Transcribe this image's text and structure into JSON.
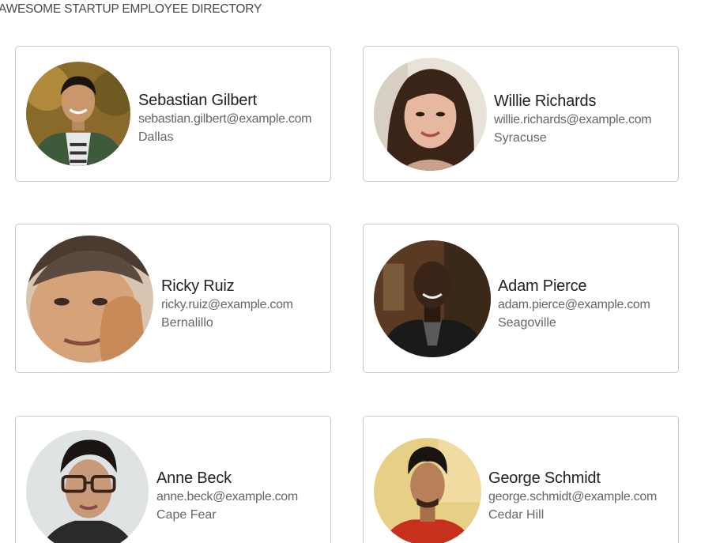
{
  "page": {
    "title": "AWESOME STARTUP EMPLOYEE DIRECTORY"
  },
  "employees": [
    {
      "name": "Sebastian Gilbert",
      "email": "sebastian.gilbert@example.com",
      "city": "Dallas"
    },
    {
      "name": "Willie Richards",
      "email": "willie.richards@example.com",
      "city": "Syracuse"
    },
    {
      "name": "Ricky Ruiz",
      "email": "ricky.ruiz@example.com",
      "city": "Bernalillo"
    },
    {
      "name": "Adam Pierce",
      "email": "adam.pierce@example.com",
      "city": "Seagoville"
    },
    {
      "name": "Anne Beck",
      "email": "anne.beck@example.com",
      "city": "Cape Fear"
    },
    {
      "name": "George Schmidt",
      "email": "george.schmidt@example.com",
      "city": "Cedar Hill"
    }
  ]
}
